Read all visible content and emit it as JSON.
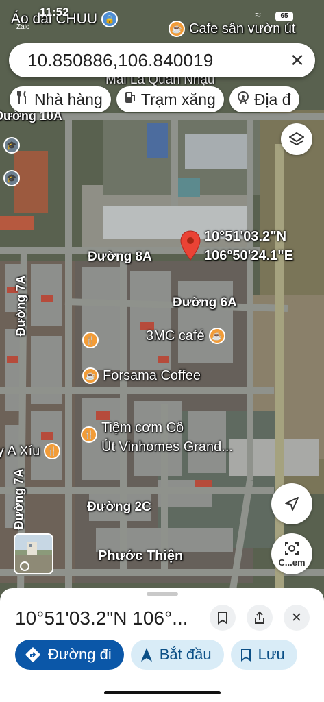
{
  "status_bar": {
    "time": "11:52",
    "app_back": "Zalo",
    "battery": "65"
  },
  "search": {
    "query": "10.850886,106.840019",
    "close_icon": "close-icon"
  },
  "chips": [
    {
      "icon": "fork-knife-icon",
      "glyph": "🍴",
      "label": "Nhà hàng"
    },
    {
      "icon": "gas-pump-icon",
      "glyph": "⛽",
      "label": "Trạm xăng"
    },
    {
      "icon": "ferris-wheel-icon",
      "glyph": "🎡",
      "label": "Địa đ"
    }
  ],
  "map": {
    "pin": {
      "coord_line1": "10°51'03.2\"N",
      "coord_line2": "106°50'24.1\"E",
      "color": "#ea4335"
    },
    "streets": {
      "duong_10a": "Đường 10A",
      "duong_8a": "Đường 8A",
      "duong_6a": "Đường 6A",
      "duong_7a_upper": "Đường 7A",
      "duong_7a_lower": "Đường 7A",
      "duong_2c": "Đường 2C",
      "phuoc_thien": "Phước Thiện",
      "mai_la": "Mai La Quán Nhậu"
    },
    "pois": {
      "ao_dai": "Áo dài CHUU",
      "cafe_san_vuon": "Cafe sân vườn út",
      "cafe_3mc": "3MC café",
      "forsama": "Forsama Coffee",
      "tiem_com_line1": "Tiệm cơm Cô",
      "tiem_com_line2": "Út Vinhomes Grand...",
      "a_xiu": "y A Xíu"
    },
    "camera_label": "C...em"
  },
  "sheet": {
    "title": "10°51'03.2\"N 106°...",
    "actions": [
      {
        "icon": "directions-icon",
        "label": "Đường đi"
      },
      {
        "icon": "navigation-arrow-icon",
        "label": "Bắt đầu"
      },
      {
        "icon": "bookmark-icon",
        "label": "Lưu"
      }
    ]
  },
  "colors": {
    "primary_blue": "#0b57a8",
    "chip_bg": "#ffffff",
    "poi_orange": "#f29c38"
  }
}
